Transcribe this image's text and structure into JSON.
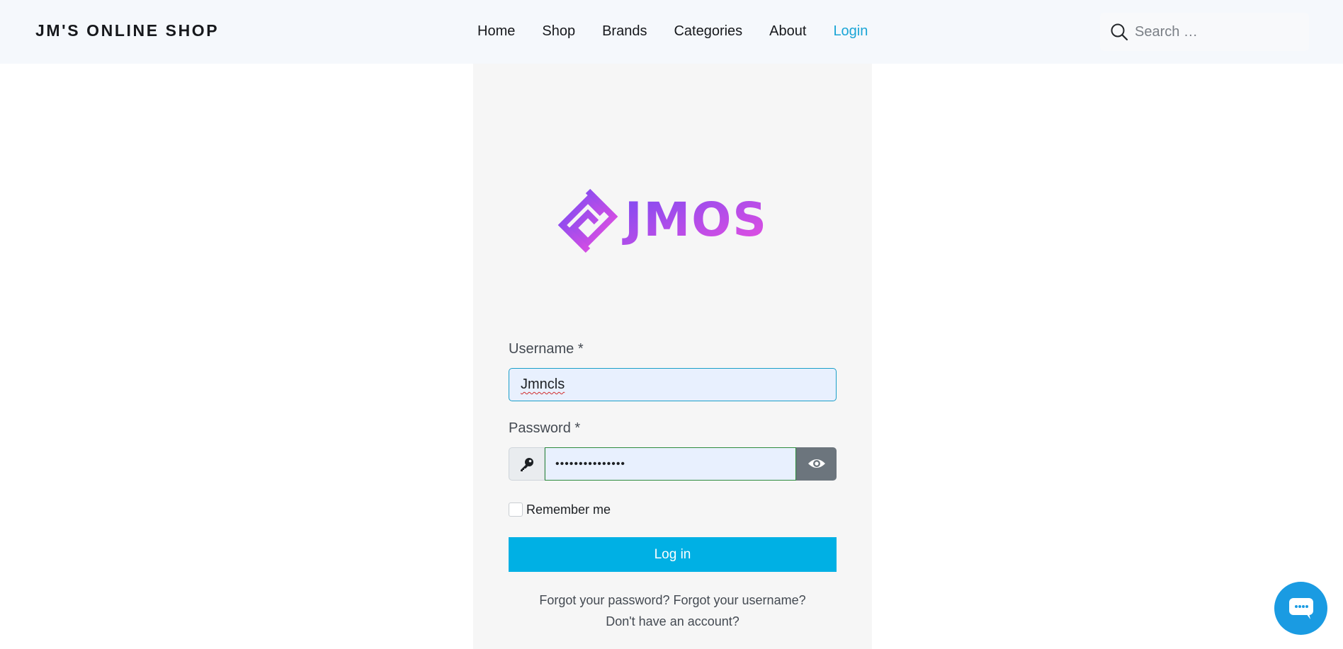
{
  "header": {
    "brand": "JM'S ONLINE SHOP",
    "nav": [
      {
        "label": "Home"
      },
      {
        "label": "Shop"
      },
      {
        "label": "Brands"
      },
      {
        "label": "Categories"
      },
      {
        "label": "About"
      },
      {
        "label": "Login",
        "active": true
      }
    ],
    "search_placeholder": "Search …",
    "search_icon": "search-icon"
  },
  "logo": {
    "text": "JMOS",
    "colors": {
      "start": "#7b4cf2",
      "end": "#e84ee0"
    }
  },
  "form": {
    "username_label": "Username *",
    "username_value": "Jmncls",
    "password_label": "Password *",
    "password_value": "•••••••••••••••",
    "key_icon": "key-icon",
    "toggle_icon": "eye-icon",
    "remember_label": "Remember me",
    "remember_checked": false,
    "submit_label": "Log in",
    "forgot_password": "Forgot your password?",
    "forgot_username": "Forgot your username?",
    "no_account": "Don't have an account?"
  },
  "chat": {
    "icon": "chat-icon"
  },
  "colors": {
    "accent": "#00b0e4",
    "nav_active": "#1aa5d6",
    "chat": "#1a9be2",
    "eye_button": "#6c757d"
  }
}
